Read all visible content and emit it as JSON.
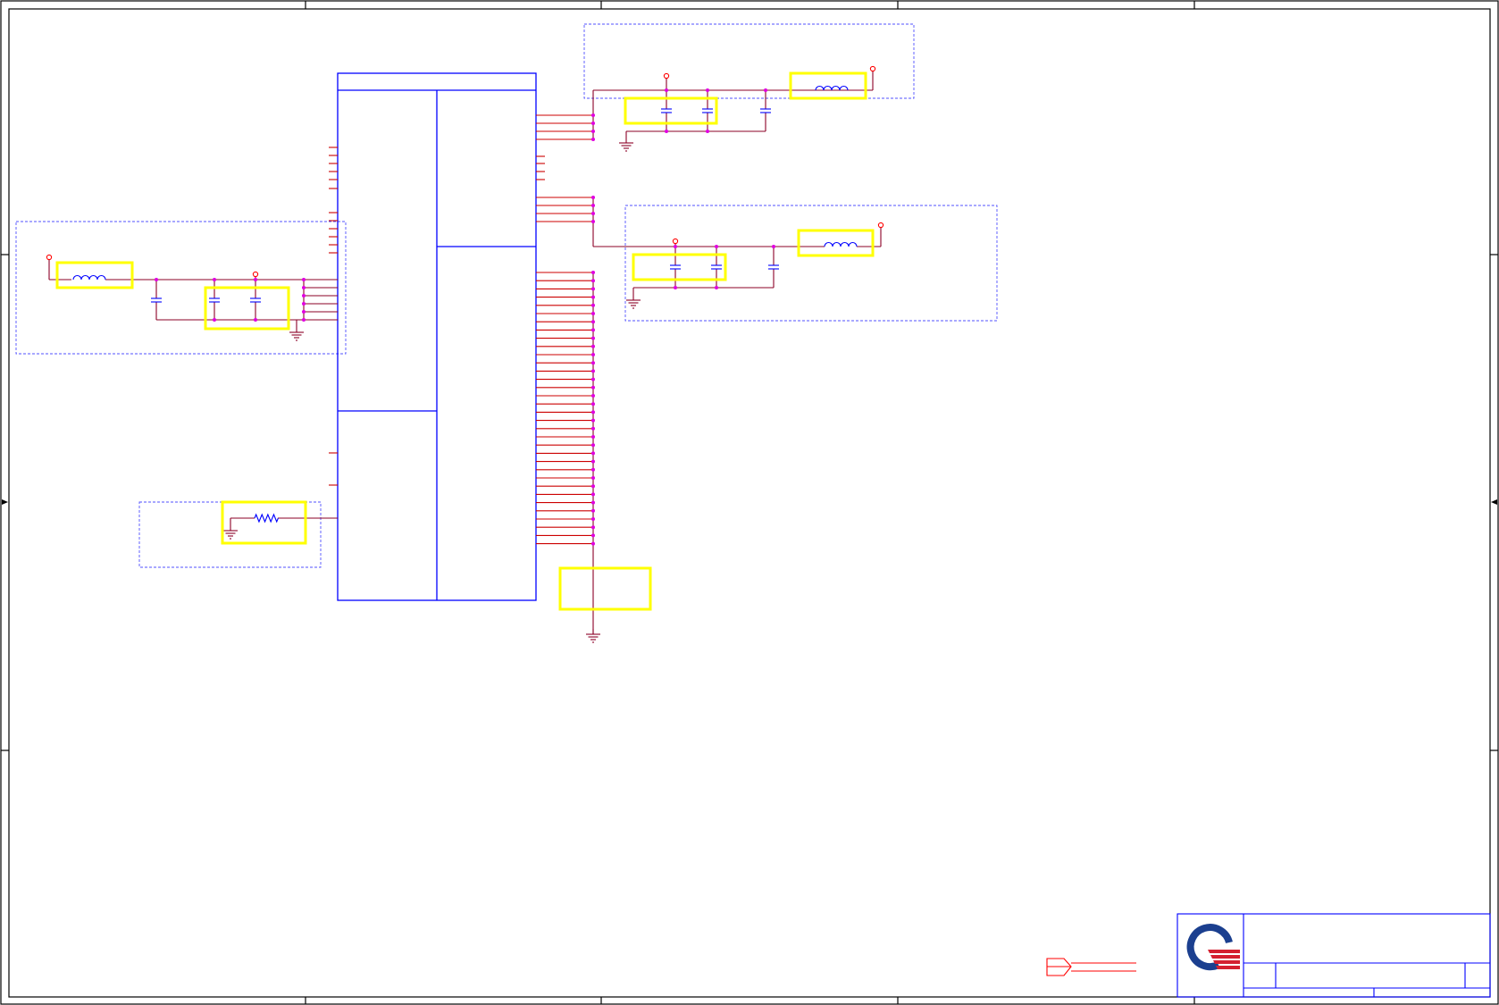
{
  "colors": {
    "background": "#ffffff",
    "frame": "#000000",
    "component": "#0000ff",
    "wire": "#8b0026",
    "pin": "#cc0000",
    "junction": "#e000e0",
    "highlight": "#ffff00",
    "group_box": "#5050ff",
    "power_port": "#ff0000",
    "logo_blue": "#1b3f8f",
    "logo_red": "#d42030"
  },
  "icons": {
    "logo": "company-logo-icon",
    "ground": "ground-icon",
    "inductor": "inductor-icon",
    "resistor": "resistor-icon",
    "capacitor": "capacitor-icon",
    "power_port": "power-port-icon",
    "off_sheet_connector": "off-sheet-connector-icon"
  },
  "schematic": {
    "ic_pin_rows_right": 34,
    "groups": 4,
    "highlights": 8
  }
}
